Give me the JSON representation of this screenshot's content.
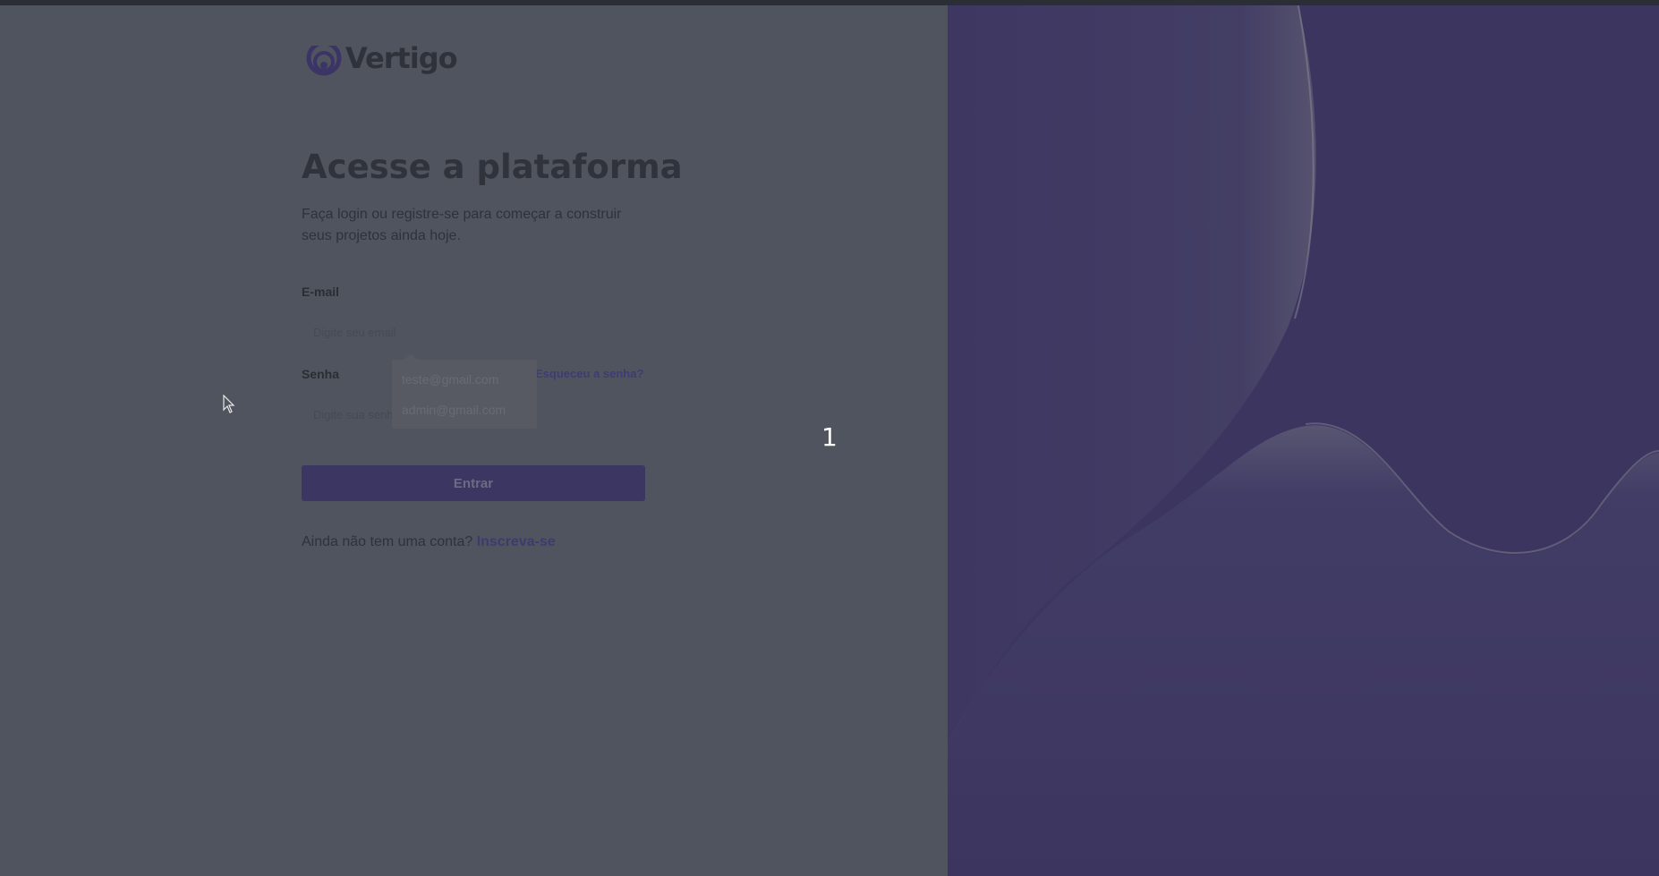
{
  "brand": {
    "name": "Vertigo",
    "logo_icon": "vertigo-swirl-icon"
  },
  "login": {
    "title": "Acesse a plataforma",
    "subtitle": "Faça login ou registre-se para começar a construir seus projetos ainda hoje.",
    "email_label": "E-mail",
    "email_placeholder": "Digite seu email",
    "password_label": "Senha",
    "password_placeholder": "Digite sua senha",
    "forgot_link": "Esqueceu a senha?",
    "submit_label": "Entrar",
    "signup_prompt": "Ainda não tem uma conta?",
    "signup_link": "Inscreva-se"
  },
  "autocomplete": {
    "options": [
      "teste@gmail.com",
      "admin@gmail.com"
    ]
  },
  "overlay": {
    "step_counter": "1"
  },
  "colors": {
    "accent": "#3c3662",
    "overlay_dim": "#50545e",
    "hero_background": "#3c3560"
  }
}
